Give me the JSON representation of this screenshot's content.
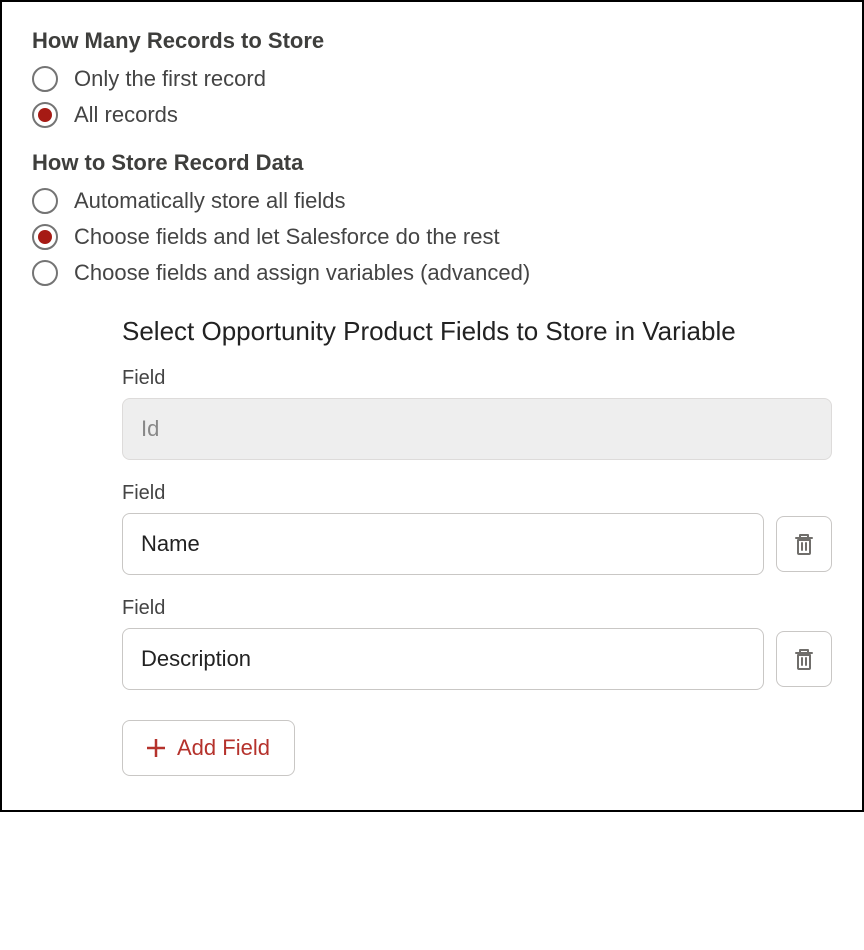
{
  "section1": {
    "title": "How Many Records to Store",
    "options": [
      {
        "label": "Only the first record",
        "selected": false
      },
      {
        "label": "All records",
        "selected": true
      }
    ]
  },
  "section2": {
    "title": "How to Store Record Data",
    "options": [
      {
        "label": "Automatically store all fields",
        "selected": false
      },
      {
        "label": "Choose fields and let Salesforce do the rest",
        "selected": true
      },
      {
        "label": "Choose fields and assign variables (advanced)",
        "selected": false
      }
    ]
  },
  "fields": {
    "heading": "Select Opportunity Product Fields to Store in Variable",
    "label": "Field",
    "rows": [
      {
        "value": "Id",
        "disabled": true,
        "deletable": false
      },
      {
        "value": "Name",
        "disabled": false,
        "deletable": true
      },
      {
        "value": "Description",
        "disabled": false,
        "deletable": true
      }
    ],
    "add_label": "Add Field"
  },
  "colors": {
    "accent_red": "#b5322c",
    "radio_red": "#a61a14",
    "icon_gray": "#706e6b"
  }
}
